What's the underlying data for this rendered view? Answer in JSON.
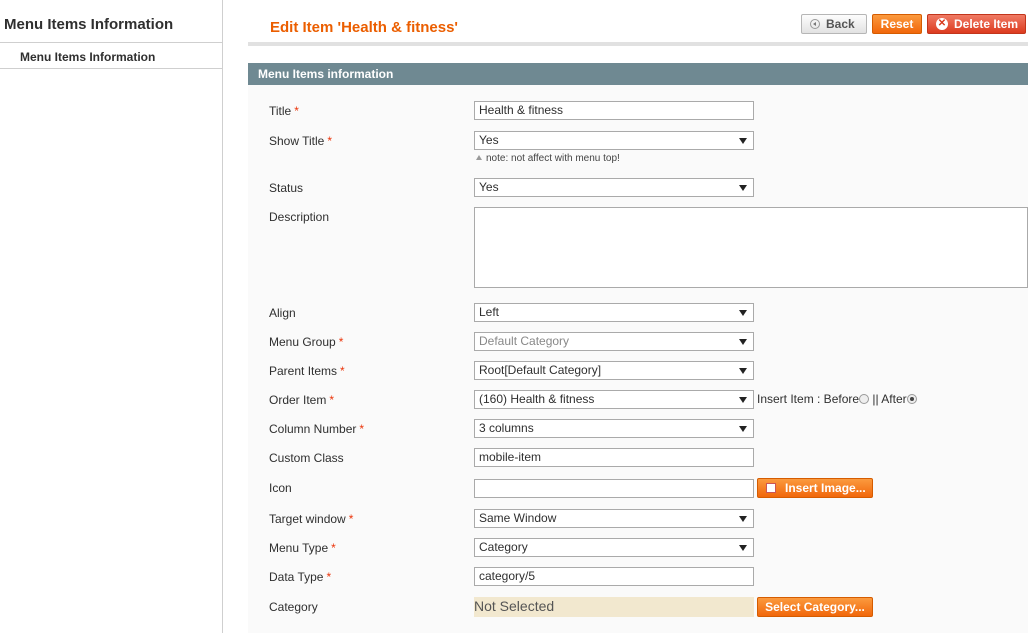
{
  "sidebar": {
    "title": "Menu Items Information",
    "items": [
      {
        "label": "Menu Items Information"
      }
    ]
  },
  "header": {
    "title": "Edit Item 'Health & fitness'",
    "back_label": "Back",
    "reset_label": "Reset",
    "delete_label": "Delete Item"
  },
  "section": {
    "title": "Menu Items information"
  },
  "form": {
    "title": {
      "label": "Title",
      "required": "*",
      "value": "Health & fitness"
    },
    "show_title": {
      "label": "Show Title",
      "required": "*",
      "value": "Yes",
      "note": "note: not affect with menu top!"
    },
    "status": {
      "label": "Status",
      "value": "Yes"
    },
    "description": {
      "label": "Description",
      "value": ""
    },
    "align": {
      "label": "Align",
      "value": "Left"
    },
    "menu_group": {
      "label": "Menu Group",
      "required": "*",
      "value": "Default Category"
    },
    "parent_items": {
      "label": "Parent Items",
      "required": "*",
      "value": "Root[Default Category]"
    },
    "order_item": {
      "label": "Order Item",
      "required": "*",
      "value": "(160) Health & fitness",
      "insert_label": "Insert Item : Before",
      "after_label": "|| After",
      "selected": "After"
    },
    "column_number": {
      "label": "Column Number",
      "required": "*",
      "value": "3 columns"
    },
    "custom_class": {
      "label": "Custom Class",
      "value": "mobile-item"
    },
    "icon": {
      "label": "Icon",
      "value": "",
      "button_label": "Insert Image..."
    },
    "target_window": {
      "label": "Target window",
      "required": "*",
      "value": "Same Window"
    },
    "menu_type": {
      "label": "Menu Type",
      "required": "*",
      "value": "Category"
    },
    "data_type": {
      "label": "Data Type",
      "required": "*",
      "value": "category/5"
    },
    "category": {
      "label": "Category",
      "value": "Not Selected",
      "button_label": "Select Category..."
    }
  },
  "colors": {
    "accent": "#eb5e00",
    "section_header": "#6f8992",
    "required": "#eb340a",
    "delete": "#dc3b1f",
    "not_selected_bg": "#f2e8cf"
  }
}
